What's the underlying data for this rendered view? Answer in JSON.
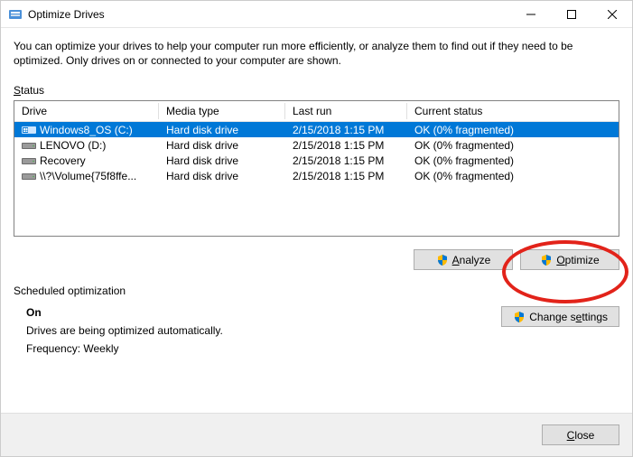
{
  "window": {
    "title": "Optimize Drives",
    "description": "You can optimize your drives to help your computer run more efficiently, or analyze them to find out if they need to be optimized. Only drives on or connected to your computer are shown."
  },
  "status": {
    "label": "Status",
    "columns": {
      "drive": "Drive",
      "media": "Media type",
      "last": "Last run",
      "curr": "Current status"
    },
    "rows": [
      {
        "icon": "os",
        "drive": "Windows8_OS (C:)",
        "media": "Hard disk drive",
        "last": "2/15/2018 1:15 PM",
        "status": "OK (0% fragmented)",
        "selected": true
      },
      {
        "icon": "hdd",
        "drive": "LENOVO (D:)",
        "media": "Hard disk drive",
        "last": "2/15/2018 1:15 PM",
        "status": "OK (0% fragmented)",
        "selected": false
      },
      {
        "icon": "hdd",
        "drive": "Recovery",
        "media": "Hard disk drive",
        "last": "2/15/2018 1:15 PM",
        "status": "OK (0% fragmented)",
        "selected": false
      },
      {
        "icon": "hdd",
        "drive": "\\\\?\\Volume{75f8ffe...",
        "media": "Hard disk drive",
        "last": "2/15/2018 1:15 PM",
        "status": "OK (0% fragmented)",
        "selected": false
      }
    ],
    "analyze_label": "Analyze",
    "optimize_label": "Optimize"
  },
  "scheduled": {
    "label": "Scheduled optimization",
    "state": "On",
    "desc": "Drives are being optimized automatically.",
    "freq": "Frequency: Weekly",
    "change_label": "Change settings"
  },
  "footer": {
    "close": "Close"
  }
}
